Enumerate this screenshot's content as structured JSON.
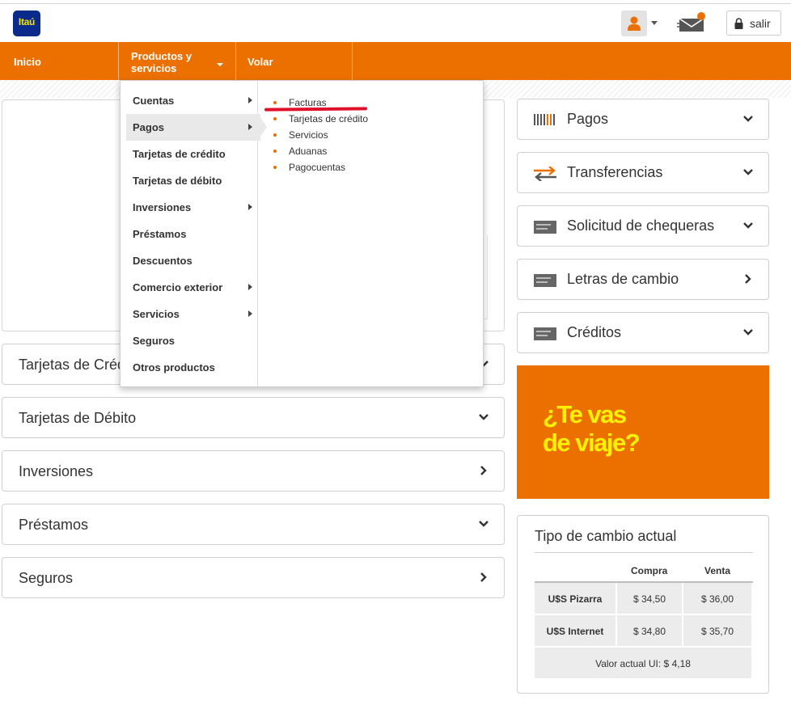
{
  "header": {
    "logo_text": "Itaú",
    "logout_label": "salir",
    "icons": [
      "user-icon",
      "mail-icon",
      "lock-icon"
    ]
  },
  "nav": {
    "inicio": "Inicio",
    "productos_line1": "Productos y",
    "productos_line2": "servicios",
    "volar": "Volar"
  },
  "menu": {
    "items": [
      {
        "label": "Cuentas",
        "has_submenu": true
      },
      {
        "label": "Pagos",
        "has_submenu": true,
        "active": true
      },
      {
        "label": "Tarjetas de crédito",
        "has_submenu": false
      },
      {
        "label": "Tarjetas de débito",
        "has_submenu": false
      },
      {
        "label": "Inversiones",
        "has_submenu": true
      },
      {
        "label": "Préstamos",
        "has_submenu": false
      },
      {
        "label": "Descuentos",
        "has_submenu": false
      },
      {
        "label": "Comercio exterior",
        "has_submenu": true
      },
      {
        "label": "Servicios",
        "has_submenu": true
      },
      {
        "label": "Seguros",
        "has_submenu": false
      },
      {
        "label": "Otros productos",
        "has_submenu": false
      }
    ],
    "submenu": [
      "Facturas",
      "Tarjetas de crédito",
      "Servicios",
      "Aduanas",
      "Pagocuentas"
    ]
  },
  "left_panels": {
    "tarjetas_credito": "Tarjetas de Crédito",
    "tarjetas_debito": "Tarjetas de Débito",
    "inversiones": "Inversiones",
    "prestamos": "Préstamos",
    "seguros": "Seguros"
  },
  "right_panels": {
    "pagos": "Pagos",
    "transferencias": "Transferencias",
    "chequeras": "Solicitud de chequeras",
    "letras": "Letras de cambio",
    "creditos": "Créditos"
  },
  "promo": {
    "line1": "¿Te vas",
    "line2": "de viaje?"
  },
  "exchange": {
    "title": "Tipo de cambio actual",
    "col_buy": "Compra",
    "col_sell": "Venta",
    "rows": [
      {
        "label": "U$S Pizarra",
        "buy": "$ 34,50",
        "sell": "$ 36,00"
      },
      {
        "label": "U$S Internet",
        "buy": "$ 34,80",
        "sell": "$ 35,70"
      }
    ],
    "ui_value": "Valor actual UI: $ 4,18"
  },
  "colors": {
    "brand_orange": "#ec7000",
    "promo_yellow": "#fff200",
    "logo_blue": "#0a2a8c",
    "annotation_red": "#e0102a"
  }
}
